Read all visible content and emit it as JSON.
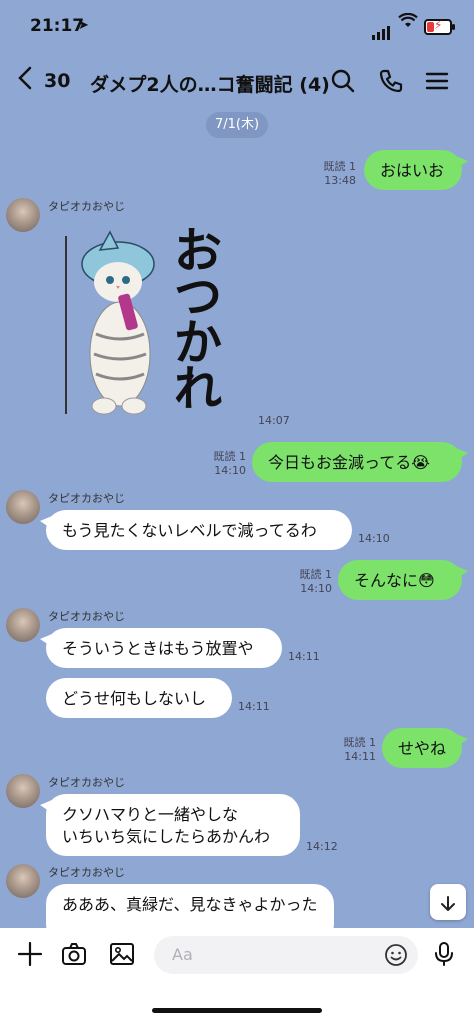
{
  "status": {
    "time": "21:17"
  },
  "header": {
    "back_count": "30",
    "title": "ダメプ2人の…コ奮闘記 (4)"
  },
  "date_label": "7/1(木)",
  "sender_name": "タピオカおやじ",
  "sticker": {
    "text": "おつかれ",
    "time": "14:07"
  },
  "messages": [
    {
      "text": "おはいお",
      "read": "既読 1",
      "time": "13:48"
    },
    {
      "text": "今日もお金減ってる😭",
      "read": "既読 1",
      "time": "14:10"
    },
    {
      "text": "もう見たくないレベルで減ってるわ",
      "time": "14:10"
    },
    {
      "text": "そんなに😳",
      "read": "既読 1",
      "time": "14:10"
    },
    {
      "text": "そういうときはもう放置や",
      "time": "14:11"
    },
    {
      "text": "どうせ何もしないし",
      "time": "14:11"
    },
    {
      "text": "せやね",
      "read": "既読 1",
      "time": "14:11"
    },
    {
      "line1": "クソハマりと一緒やしな",
      "line2": "いちいち気にしたらあかんわ",
      "time": "14:12"
    },
    {
      "text": "あああ、真緑だ、見なきゃよかった"
    }
  ],
  "input": {
    "placeholder": "Aa"
  },
  "icons": {
    "back": "chevron-left-icon",
    "search": "search-icon",
    "phone": "phone-icon",
    "menu": "menu-icon",
    "plus": "plus-icon",
    "camera": "camera-icon",
    "image": "image-icon",
    "emoji": "emoji-icon",
    "mic": "mic-icon",
    "scroll": "arrow-down-icon"
  },
  "colors": {
    "background": "#8fa7d3",
    "my_bubble": "#7ce26a",
    "their_bubble": "#ffffff"
  }
}
